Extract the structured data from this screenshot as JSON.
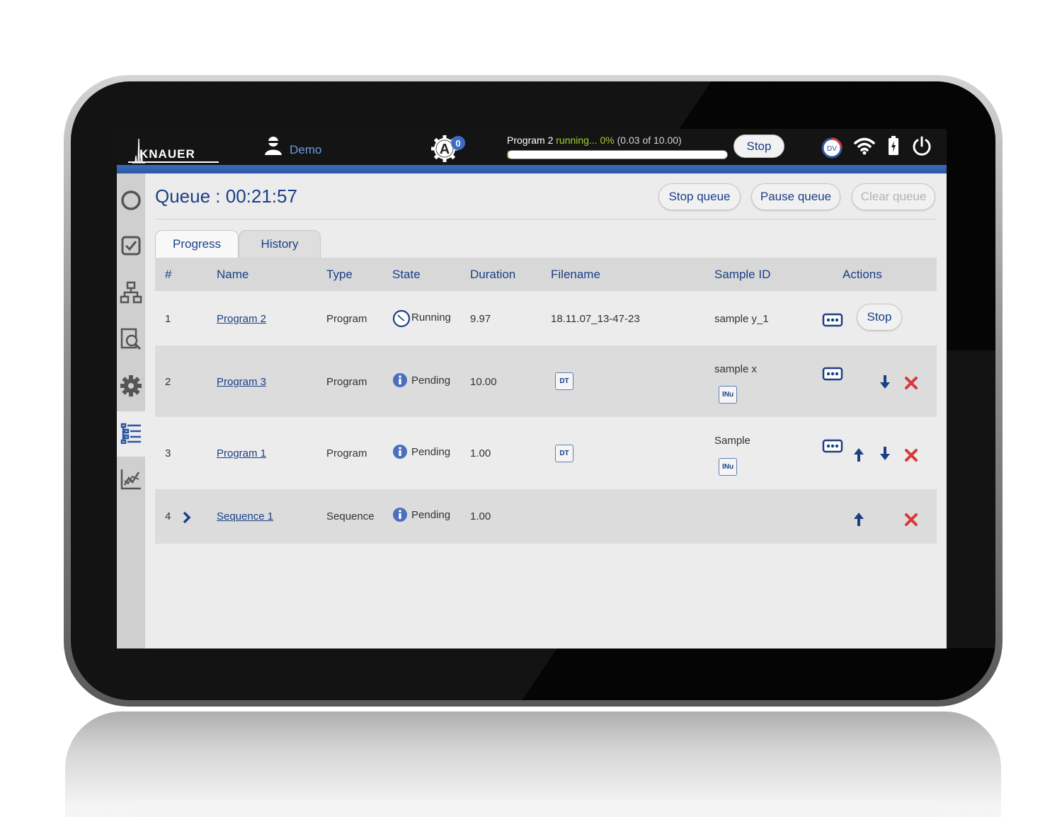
{
  "topbar": {
    "brand": "KNAUER",
    "user": "Demo",
    "auto_badge_count": "0",
    "program_name": "Program 2",
    "program_state": "running...",
    "program_percent": "0%",
    "program_detail": "(0.03 of 10.00)",
    "progress_fraction": 0.003,
    "stop_label": "Stop",
    "dv_label": "DV"
  },
  "header": {
    "title": "Queue : 00:21:57",
    "stop_queue": "Stop queue",
    "pause_queue": "Pause queue",
    "clear_queue": "Clear queue"
  },
  "tabs": {
    "progress": "Progress",
    "history": "History"
  },
  "columns": {
    "num": "#",
    "name": "Name",
    "type": "Type",
    "state": "State",
    "duration": "Duration",
    "filename": "Filename",
    "sample_id": "Sample ID",
    "actions": "Actions"
  },
  "rows": [
    {
      "num": "1",
      "name": "Program 2",
      "type": "Program",
      "state": "Running",
      "duration": "9.97",
      "filename": "18.11.07_13-47-23",
      "sample_id": "sample y_1",
      "stop": "Stop"
    },
    {
      "num": "2",
      "name": "Program 3",
      "type": "Program",
      "state": "Pending",
      "duration": "10.00",
      "filename_tag": "DT",
      "sample_id": "sample x",
      "sample_tag": "INu"
    },
    {
      "num": "3",
      "name": "Program 1",
      "type": "Program",
      "state": "Pending",
      "duration": "1.00",
      "filename_tag": "DT",
      "sample_id": "Sample",
      "sample_tag": "INu"
    },
    {
      "num": "4",
      "name": "Sequence 1",
      "type": "Sequence",
      "state": "Pending",
      "duration": "1.00"
    }
  ],
  "colors": {
    "accent_blue": "#1b3f86",
    "header_bar": "#141414",
    "running_green": "#a8d22b",
    "delete_red": "#d9383a"
  }
}
